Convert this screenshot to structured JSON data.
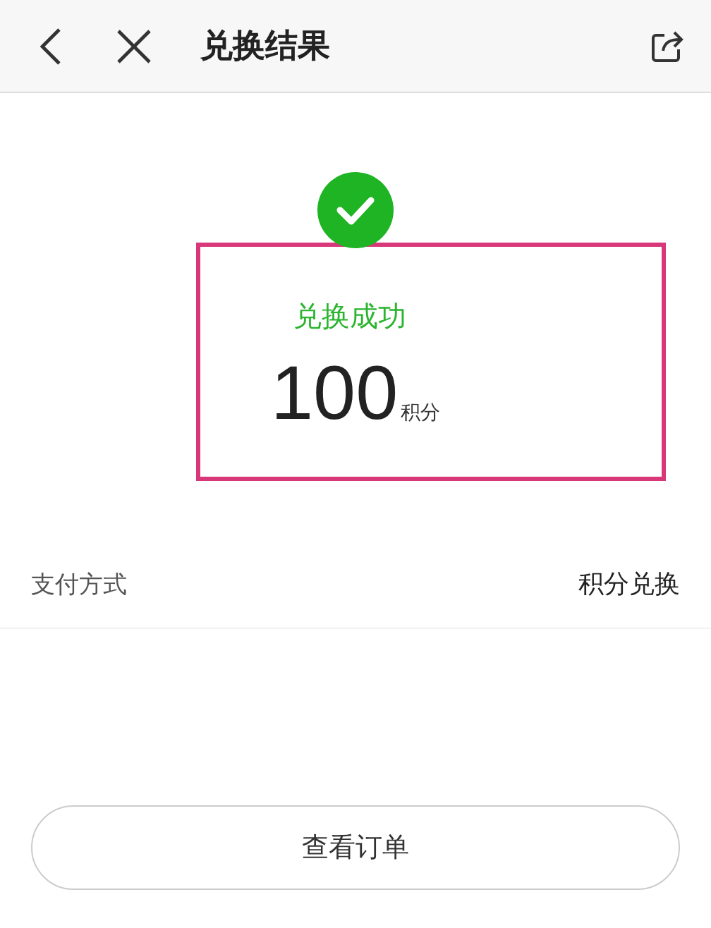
{
  "header": {
    "title": "兑换结果"
  },
  "result": {
    "status": "兑换成功",
    "amount": "100",
    "unit": "积分"
  },
  "payment": {
    "label": "支付方式",
    "value": "积分兑换"
  },
  "button": "查看订单"
}
